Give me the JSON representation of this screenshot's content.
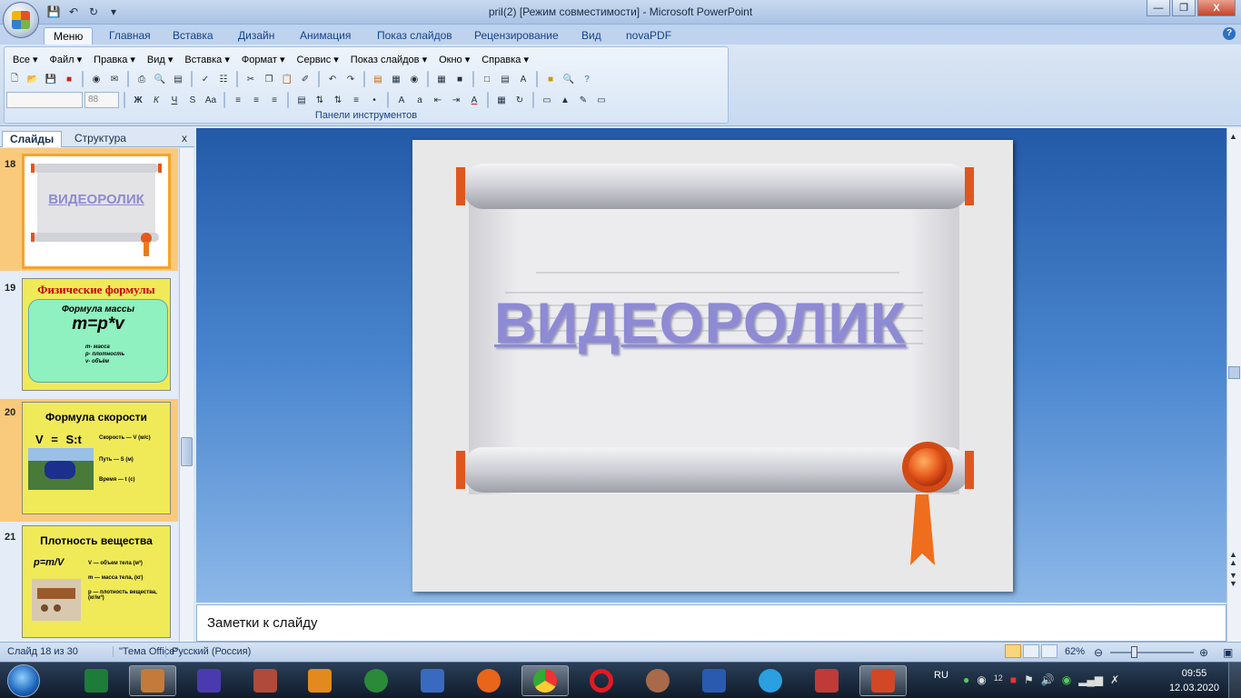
{
  "window": {
    "title": "pril(2) [Режим совместимости] - Microsoft PowerPoint"
  },
  "tabs": [
    "Меню",
    "Главная",
    "Вставка",
    "Дизайн",
    "Анимация",
    "Показ слайдов",
    "Рецензирование",
    "Вид",
    "novaPDF"
  ],
  "menu": [
    "Все",
    "Файл",
    "Правка",
    "Вид",
    "Вставка",
    "Формат",
    "Сервис",
    "Показ слайдов",
    "Окно",
    "Справка"
  ],
  "toolbar": {
    "font_size": "88",
    "group_label": "Панели инструментов"
  },
  "left_panel": {
    "tab_slides": "Слайды",
    "tab_outline": "Структура",
    "close": "x"
  },
  "thumbnails": [
    {
      "num": "18",
      "title": "ВИДЕОРОЛИК"
    },
    {
      "num": "19",
      "title": "Физические формулы",
      "subtitle": "Формула массы",
      "formula": "m=p*v",
      "legend": [
        "m- масса",
        "p- плотность",
        "v- объём"
      ]
    },
    {
      "num": "20",
      "title": "Формула скорости",
      "formula": "V = S:t",
      "legend": [
        "Скорость — V (м/с)",
        "Путь — S (м)",
        "Время — t (с)"
      ]
    },
    {
      "num": "21",
      "title": "Плотность вещества",
      "formula": "p=m/V",
      "legend": [
        "V — объем тела (м³)",
        "m — масса тела, (кг)",
        "p — плотность вещества, (кг/м³)"
      ]
    }
  ],
  "slide": {
    "title": "ВИДЕОРОЛИК"
  },
  "notes": {
    "placeholder": "Заметки к слайду"
  },
  "status": {
    "slide": "Слайд 18 из 30",
    "theme": "\"Тема Office\"",
    "language": "Русский (Россия)",
    "zoom": "62%",
    "zoom_level": 0.62
  },
  "taskbar": {
    "lang": "RU",
    "time": "09:55",
    "date": "12.03.2020",
    "badge": "12"
  },
  "colors": {
    "accent": "#f7a32c",
    "title_text": "#8e8ad4",
    "thumb_yellow": "#f0ea58",
    "thumb_green": "#8ff0c0"
  }
}
